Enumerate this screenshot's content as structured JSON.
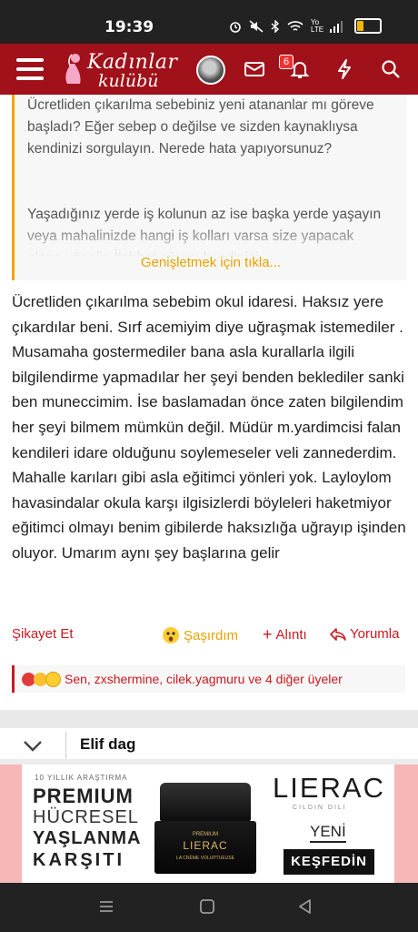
{
  "status_bar": {
    "time": "19:39",
    "network": "Yo LTE",
    "signal_icon": "signal-icon",
    "wifi_icon": "wifi-icon",
    "battery_level": 0.3
  },
  "navbar": {
    "logo_line1": "Kadınlar",
    "logo_line2": "kulübü",
    "notification_count": "6",
    "background": "#a0111a"
  },
  "quote": {
    "paragraph1": "Ücretliden çıkarılma sebebiniz yeni atananlar mı göreve başladı? Eğer sebep o değilse ve sizden kaynaklıysa kendinizi sorgulayın. Nerede hata yapıyorsunuz?",
    "paragraph2": "Yaşadığınız yerde iş kolunun az ise başka yerde yaşayın veya mahalinizde hangi iş kolları varsa size yapacak alana yönelin.İlahbet sürem kendinizi",
    "expand_label": "Genişletmek için tıkla..."
  },
  "post": {
    "body": "Ücretliden çıkarılma sebebim okul idaresi. Haksız yere çıkardılar beni. Sırf acemiyim diye uğraşmak istemediler . Musamaha gostermediler bana asla kurallarla ilgili bilgilendirme yapmadılar her şeyi benden beklediler sanki ben muneccimim. İse baslamadan önce zaten bilgilendim her şeyi bilmem mümkün değil. Müdür m.yardimcisi falan kendileri idare olduğunu soylemeseler veli zannederdim. Mahalle karıları gibi asla eğitimci yönleri yok. Layloylom havasindalar okula karşı ilgisizlerdi böyleleri haketmiyor eğitimci olmayı benim gibilerde haksızlığa uğrayıp işinden oluyor. Umarım aynı şey başlarına gelir"
  },
  "actions": {
    "report": "Şikayet Et",
    "reaction": "Şaşırdım",
    "quote": "Alıntı",
    "reply": "Yorumla"
  },
  "reactions": {
    "text": "Sen, zxshermine, cilek.yagmuru ve 4 diğer üyeler"
  },
  "next_post": {
    "username": "Elif dag"
  },
  "ad": {
    "small_top": "10 YILLIK ARAŞTIRMA",
    "line1": "PREMIUM",
    "line2": "HÜCRESEL",
    "line3": "YAŞLANMA",
    "line4": "KARŞITI",
    "jar_top": "PREMIUM",
    "jar_brand": "LIERAC",
    "jar_sub": "LA CRÈME VOLUPTUEUSE",
    "brand": "LIERAC",
    "brand_sub": "CILDIN DILI",
    "new_label": "YENİ",
    "cta": "KEŞFEDİN"
  },
  "colors": {
    "accent": "#c81a21",
    "quote_border": "#f0a500",
    "expand": "#e8a200"
  }
}
